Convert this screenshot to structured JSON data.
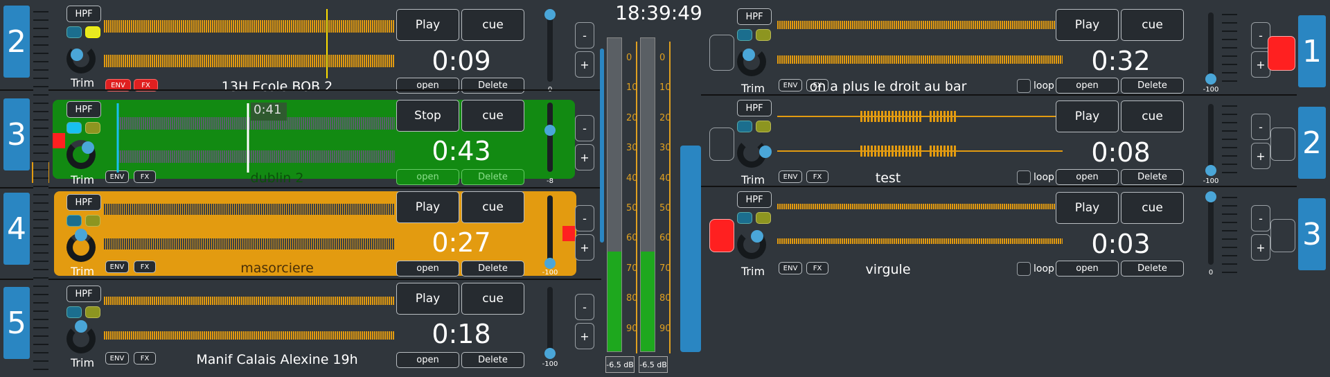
{
  "clock": "18:39:49",
  "colors": {
    "accent": "#2a86c2",
    "waveform": "#e39b10",
    "playing_bg": "#128a12",
    "selected_bg": "#e39b10",
    "red": "#ff2020",
    "green_meter": "#1ea81e"
  },
  "common": {
    "hpf": "HPF",
    "trim": "Trim",
    "env": "ENV",
    "fx": "FX",
    "cue": "cue",
    "open": "open",
    "delete": "Delete",
    "minus": "-",
    "plus": "+",
    "loop": "loop"
  },
  "left_decks": [
    {
      "num": "2",
      "play": "Play",
      "time": "0:09",
      "title": "13H Ecole BOB 2",
      "slider_label": "0",
      "fader": 1.0
    },
    {
      "num": "3",
      "play": "Stop",
      "time": "0:43",
      "title": "dublin 2",
      "slider_label": "-8",
      "elapsed": "0:41",
      "fader": 0.62
    },
    {
      "num": "4",
      "play": "Play",
      "time": "0:27",
      "title": "masorciere",
      "slider_label": "-100",
      "fader": 0.0
    },
    {
      "num": "5",
      "play": "Play",
      "time": "0:18",
      "title": "Manif Calais Alexine 19h",
      "slider_label": "-100",
      "fader": 0.0
    }
  ],
  "right_decks": [
    {
      "num": "1",
      "play": "Play",
      "time": "0:32",
      "title": "on a plus le droit au bar",
      "slider_label": "-100",
      "fader": 0.0
    },
    {
      "num": "2",
      "play": "Play",
      "time": "0:08",
      "title": "test",
      "slider_label": "-100",
      "fader": 0.0
    },
    {
      "num": "3",
      "play": "Play",
      "time": "0:03",
      "title": "virgule",
      "slider_label": "0",
      "fader": 1.0
    }
  ],
  "meter": {
    "scale": [
      "0",
      "10",
      "20",
      "30",
      "40",
      "50",
      "60",
      "70",
      "80",
      "90"
    ],
    "left_db": "-6.5 dB",
    "right_db": "-6.5 dB",
    "left_level": 0.42,
    "right_level": 0.42
  }
}
